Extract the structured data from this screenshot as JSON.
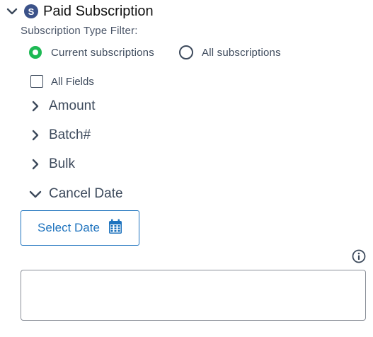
{
  "section": {
    "title": "Paid Subscription",
    "badge_letter": "S",
    "expanded": true
  },
  "filter": {
    "label": "Subscription Type Filter:",
    "options": [
      {
        "label": "Current subscriptions",
        "selected": true
      },
      {
        "label": "All subscriptions",
        "selected": false
      }
    ]
  },
  "all_fields": {
    "label": "All Fields",
    "checked": false
  },
  "fields": [
    {
      "label": "Amount",
      "expanded": false
    },
    {
      "label": "Batch#",
      "expanded": false
    },
    {
      "label": "Bulk",
      "expanded": false
    },
    {
      "label": "Cancel Date",
      "expanded": true
    }
  ],
  "date_picker": {
    "button_label": "Select Date",
    "icon": "calendar-icon"
  },
  "notes": {
    "value": "",
    "info_icon": "info-icon"
  },
  "colors": {
    "accent_blue": "#1e73be",
    "radio_selected": "#1db954",
    "badge_bg": "#3b5289",
    "text": "#3d4a5c"
  }
}
